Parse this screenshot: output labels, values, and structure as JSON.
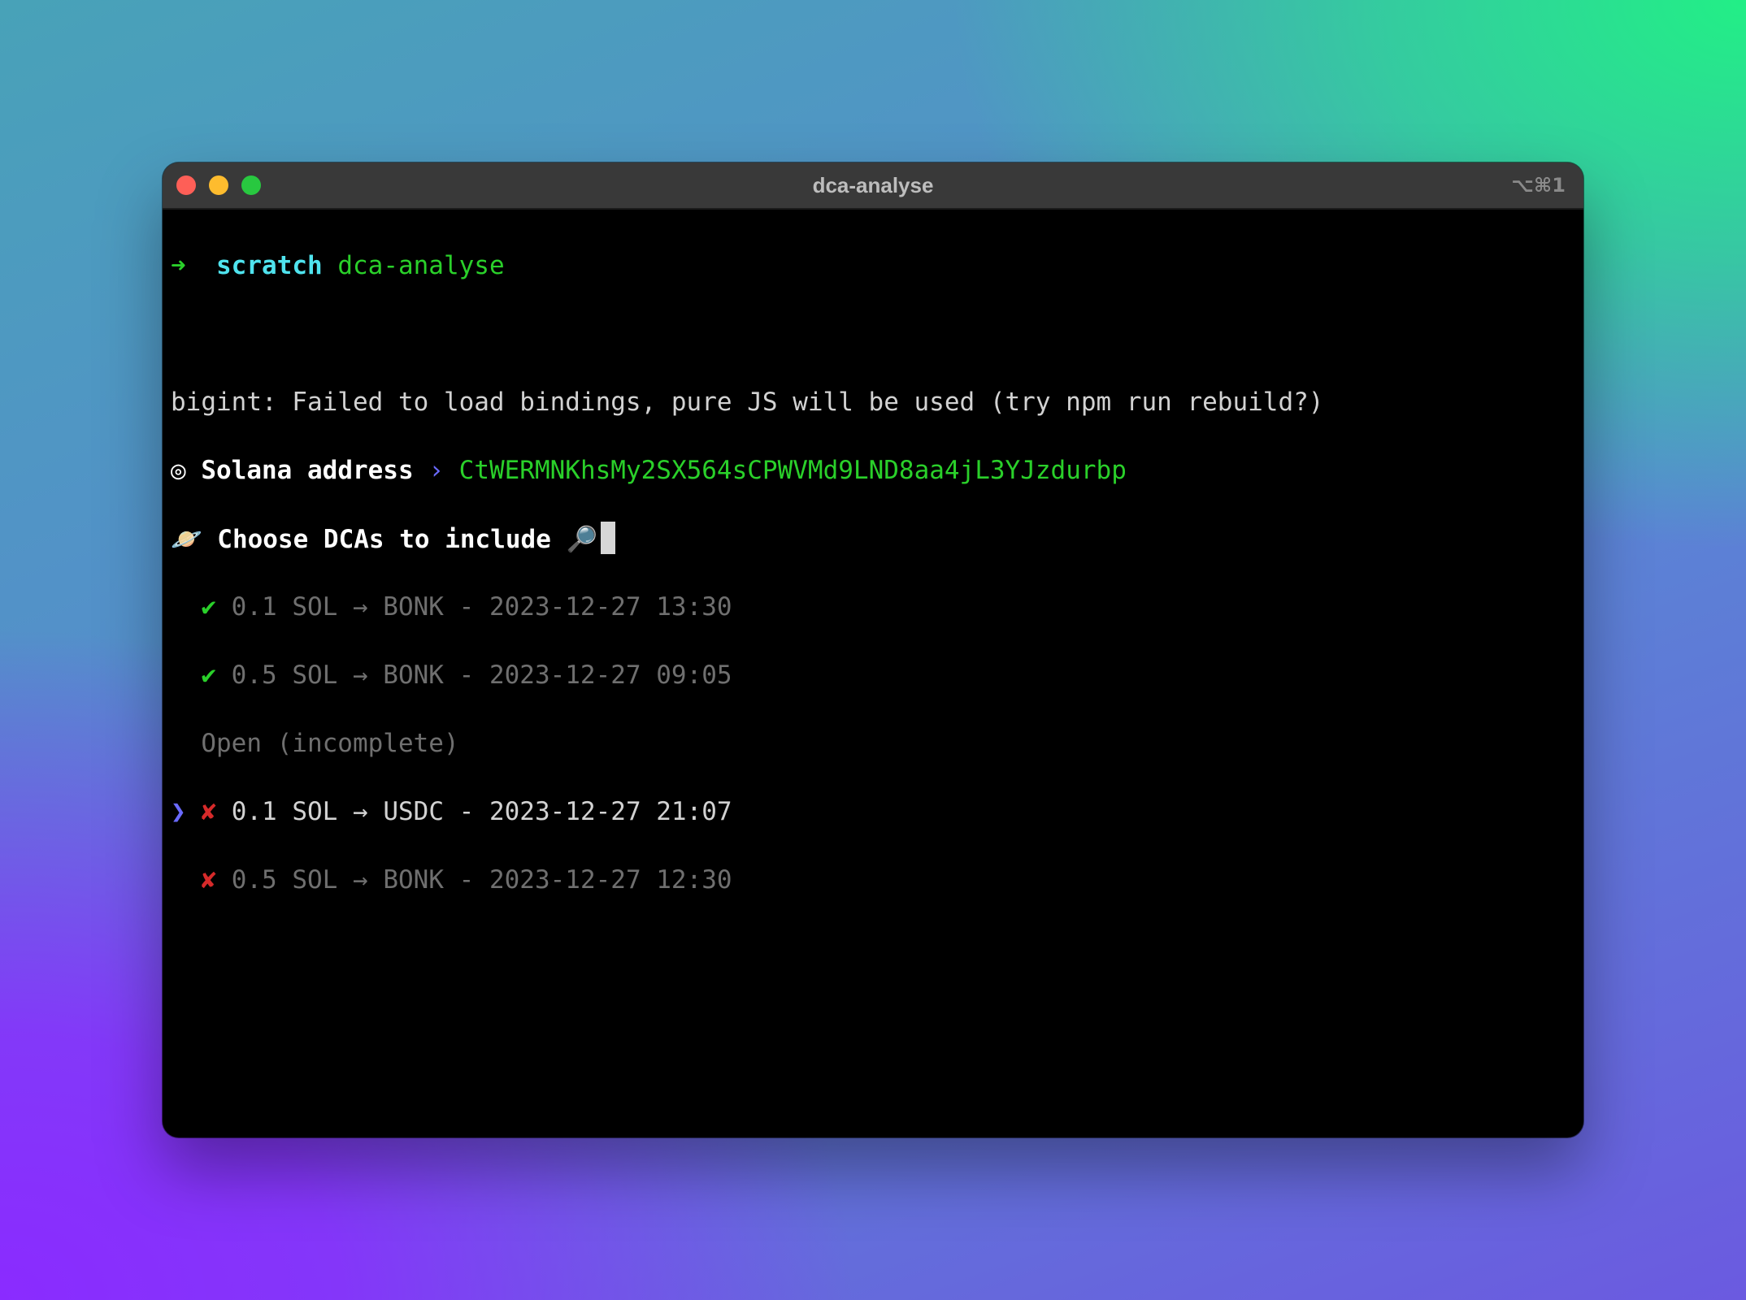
{
  "window": {
    "title": "dca-analyse",
    "shortcut": "⌥⌘1"
  },
  "prompt": {
    "arrow": "➜",
    "dir": "scratch",
    "command": "dca-analyse"
  },
  "warning": "bigint: Failed to load bindings, pure JS will be used (try npm run rebuild?)",
  "address_prompt": {
    "icon": "◎",
    "label": "Solana address",
    "separator": "›",
    "value": "CtWERMNKhsMy2SX564sCPWVMd9LND8aa4jL3YJzdurbp"
  },
  "choose_prompt": {
    "icon": "🪐",
    "label": "Choose DCAs to include",
    "search_icon": "🔎"
  },
  "options": [
    {
      "mark": "✔",
      "text": "0.1 SOL → BONK - 2023-12-27 13:30",
      "state": "selected"
    },
    {
      "mark": "✔",
      "text": "0.5 SOL → BONK - 2023-12-27 09:05",
      "state": "selected"
    }
  ],
  "group_label": "Open (incomplete)",
  "open_options": [
    {
      "pointer": "❯",
      "mark": "✘",
      "text": "0.1 SOL → USDC - 2023-12-27 21:07",
      "state": "focused"
    },
    {
      "pointer": " ",
      "mark": "✘",
      "text": "0.5 SOL → BONK - 2023-12-27 12:30",
      "state": "unselected"
    }
  ],
  "colors": {
    "success": "#2ad02a",
    "error": "#d62a2a",
    "pointer": "#6a6aff",
    "dir": "#4fe3ee"
  }
}
